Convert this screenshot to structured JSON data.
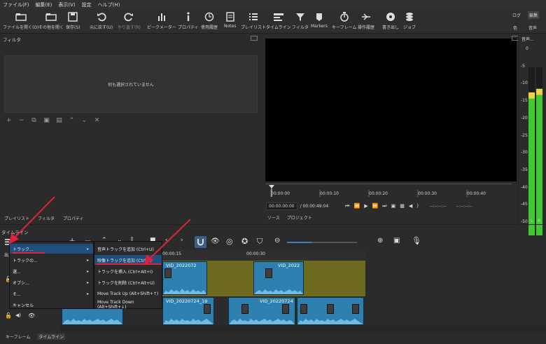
{
  "menubar": [
    "ファイル(F)",
    "編集(E)",
    "表示(V)",
    "設定",
    "ヘルプ(H)"
  ],
  "toolbar": [
    {
      "label": "ファイルを開く(O)",
      "icon": "folder-open-icon"
    },
    {
      "label": "その他を開く",
      "icon": "folder-open-more-icon"
    },
    {
      "label": "保存(S)",
      "icon": "save-icon"
    },
    {
      "label": "元に戻す(U)",
      "icon": "undo-icon"
    },
    {
      "label": "やり直す(R)",
      "icon": "redo-icon"
    },
    {
      "label": "ピークメーター",
      "icon": "peak-meter-icon"
    },
    {
      "label": "プロパティ",
      "icon": "info-icon"
    },
    {
      "label": "使用履歴",
      "icon": "history-icon"
    },
    {
      "label": "Notes",
      "icon": "notes-icon"
    },
    {
      "label": "プレイリスト",
      "icon": "playlist-icon"
    },
    {
      "label": "タイムライン",
      "icon": "timeline-icon"
    },
    {
      "label": "フィルタ",
      "icon": "filter-icon"
    },
    {
      "label": "Markers",
      "icon": "markers-icon"
    },
    {
      "label": "キーフレーム",
      "icon": "keyframe-icon"
    },
    {
      "label": "操作履歴",
      "icon": "jobs-history-icon"
    },
    {
      "label": "書き出し",
      "icon": "export-icon"
    },
    {
      "label": "ジョブ",
      "icon": "jobs-icon"
    }
  ],
  "toolbar_right": {
    "top1": "ログ",
    "top2": "編集",
    "bottom1": "色",
    "bottom2": "音声"
  },
  "filter_panel": {
    "title": "フィルタ",
    "empty_text": "何も選択されていません"
  },
  "player": {
    "ticks": [
      "00:00:00",
      "00:00:10",
      "00:00:20",
      "00:00:30",
      "00:00:40"
    ],
    "current_time": "00:00:00:00",
    "total_time": "/ 00:00:49:04",
    "in_point": "--:--:--:--",
    "out_point": "--:--:--:--",
    "tabs": [
      "ソース",
      "プロジェクト"
    ]
  },
  "meter": {
    "title": "音声...",
    "scale": [
      "0",
      "-5",
      "-10",
      "-15",
      "-20",
      "-25",
      "-30",
      "-35",
      "-40",
      "-45",
      "-50"
    ],
    "channels": [
      "L",
      "R"
    ],
    "level_left": 0.86,
    "level_right": 0.88
  },
  "left_tabs": [
    "プレイリスト",
    "フィルタ",
    "プロパティ"
  ],
  "timeline_title": "タイムライン",
  "timeline": {
    "ruler_ticks": [
      "00:00:15",
      "00:00:30"
    ],
    "header_label": "出力",
    "clips_v1": [
      "VID_2022072",
      "VID_2022"
    ],
    "clips_v2": [
      "VID_20220724_19",
      "VID_20220724"
    ]
  },
  "context_menu": {
    "items": [
      {
        "label": "トラック...",
        "submenu": true
      },
      {
        "label": "トラックの...",
        "submenu": true
      },
      {
        "label": "選...",
        "submenu": true
      },
      {
        "label": "オプシ...",
        "submenu": true
      },
      {
        "label": "そ...",
        "submenu": true
      },
      {
        "label": "キャンセル",
        "submenu": false
      }
    ],
    "submenu": [
      "音声トラックを追加 (Ctrl+U)",
      "映像トラックを追加 (Ctrl+I)",
      "トラックを挿入 (Ctrl+Alt+I)",
      "トラックを削除 (Ctrl+Alt+U)",
      "Move Track Up (Alt+Shift+↑)",
      "Move Track Down (Alt+Shift+↓)"
    ]
  },
  "bottom_tabs": [
    "キーフレーム",
    "タイムライン"
  ],
  "colors": {
    "annotation": "#e0203a",
    "selection": "#1f4f7a",
    "clip": "#2d7fb0",
    "track_bg": "#6e6a1f",
    "meter_green": "#41c832",
    "meter_yellow": "#e8d640"
  }
}
